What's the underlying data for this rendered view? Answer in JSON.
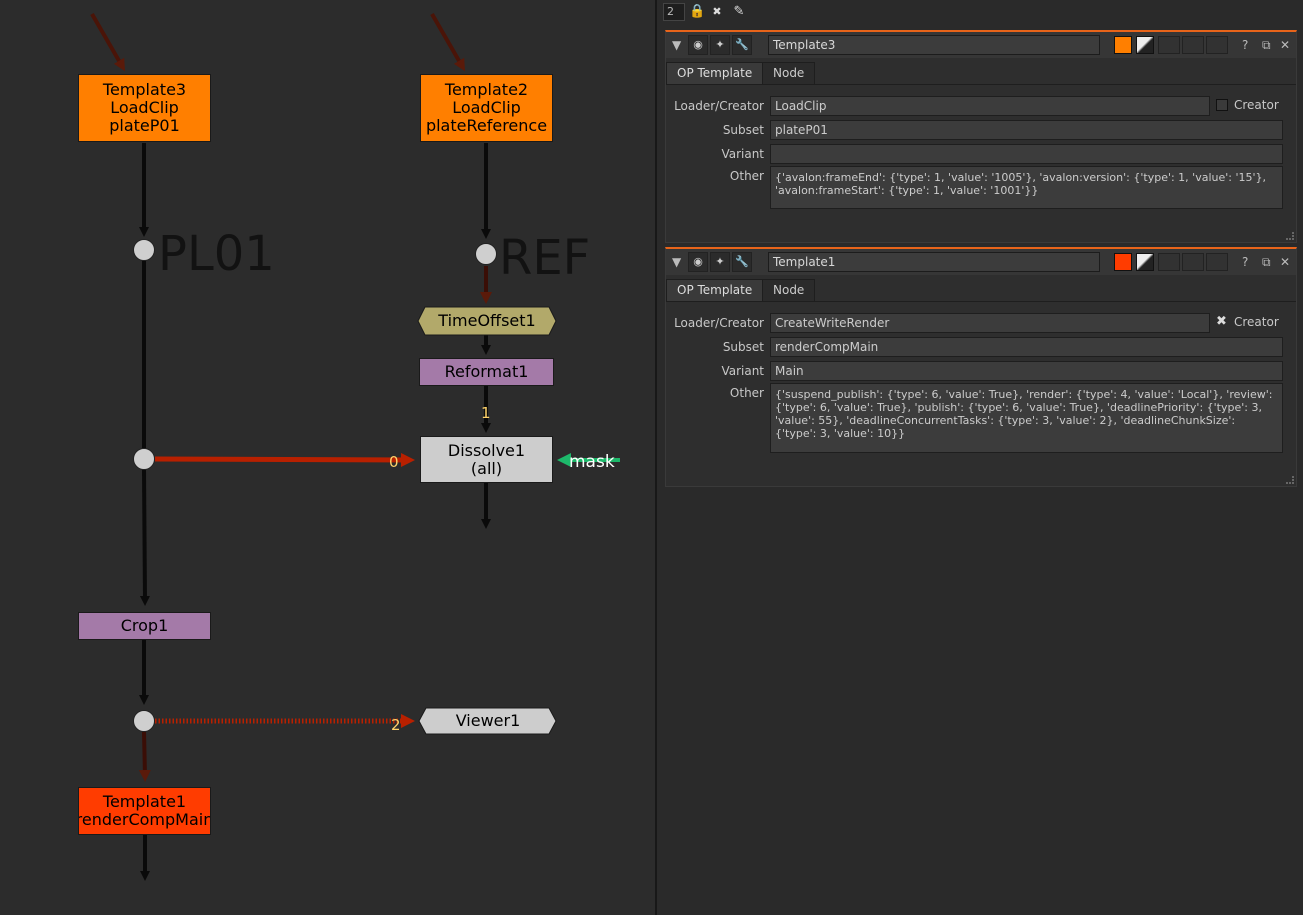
{
  "nodes": {
    "template3": [
      "Template3",
      "LoadClip",
      "plateP01"
    ],
    "template2": [
      "Template2",
      "LoadClip",
      "plateReference"
    ],
    "timeoffset": "TimeOffset1",
    "reformat": "Reformat1",
    "dissolve": [
      "Dissolve1",
      "(all)"
    ],
    "crop": "Crop1",
    "viewer": "Viewer1",
    "template1": [
      "Template1",
      "renderCompMain"
    ],
    "dot_label_pl": "PL01",
    "dot_label_ref": "REF"
  },
  "inputs": {
    "dissolve_input_1": "1",
    "dissolve_input_0": "0",
    "dissolve_mask": "mask",
    "viewer_input_2": "2"
  },
  "colors": {
    "template_load": "#ff7f00",
    "template_render": "#ff3c00",
    "timeoffset": "#b2a96a",
    "purple": "#a47aa8",
    "grey": "#cdcdcd",
    "pipe_red": "#b82000",
    "pipe_black": "#0a0a0a",
    "mask_green": "#1db86a",
    "accent": "#e8641a"
  },
  "toolbar": {
    "panel_count": "2",
    "lock_icon": "lock-icon",
    "close_all_icon": "close-all-icon",
    "edit_icon": "pencil-icon"
  },
  "panels": [
    {
      "name": "Template3",
      "tab_active": "OP Template",
      "tab_other": "Node",
      "labels": {
        "loader": "Loader/Creator",
        "subset": "Subset",
        "variant": "Variant",
        "other": "Other"
      },
      "loader": "LoadClip",
      "creator_label": "Creator",
      "creator_checked": false,
      "subset": "plateP01",
      "variant": "",
      "other": "{'avalon:frameEnd': {'type': 1, 'value': '1005'}, 'avalon:version': {'type': 1, 'value': '15'}, 'avalon:frameStart': {'type': 1, 'value': '1001'}}",
      "swatch_color": "#ff7f00"
    },
    {
      "name": "Template1",
      "tab_active": "OP Template",
      "tab_other": "Node",
      "labels": {
        "loader": "Loader/Creator",
        "subset": "Subset",
        "variant": "Variant",
        "other": "Other"
      },
      "loader": "CreateWriteRender",
      "creator_label": "Creator",
      "creator_checked": true,
      "subset": "renderCompMain",
      "variant": "Main",
      "other": "{'suspend_publish': {'type': 6, 'value': True}, 'render': {'type': 4, 'value': 'Local'}, 'review': {'type': 6, 'value': True}, 'publish': {'type': 6, 'value': True}, 'deadlinePriority': {'type': 3, 'value': 55}, 'deadlineConcurrentTasks': {'type': 3, 'value': 2}, 'deadlineChunkSize': {'type': 3, 'value': 10}}",
      "swatch_color": "#ff3c00"
    }
  ]
}
